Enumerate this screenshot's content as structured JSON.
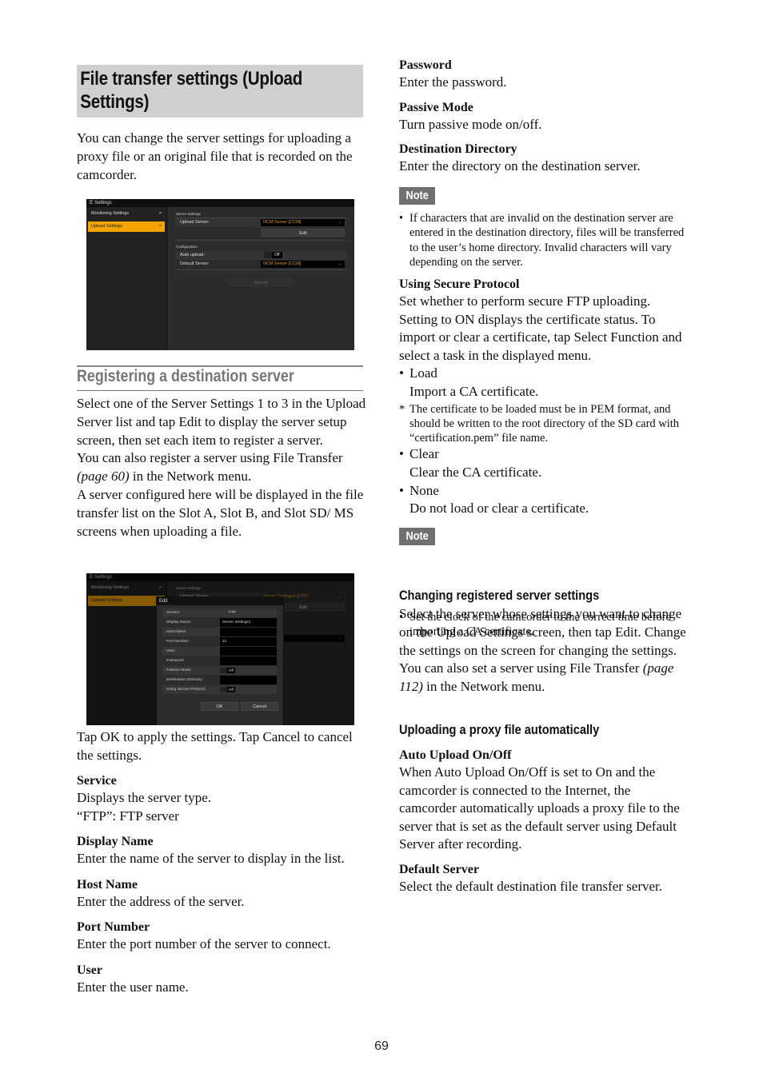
{
  "page": {
    "title": "File transfer settings (Upload Settings)",
    "intro": "You can change the server settings for uploading a proxy file or an original file that is recorded on the camcorder.",
    "page_number": "69"
  },
  "screenshot1": {
    "window_title": "Settings",
    "sidebar": [
      {
        "label": "Monitoring Settings",
        "chevron": ">"
      },
      {
        "label": "Upload Settings",
        "chevron": ">",
        "active": true
      }
    ],
    "server_settings_label": "Server Settings",
    "upload_server_label": "Upload Server:",
    "upload_server_value": "NCM Server [CCM]",
    "edit_button": "Edit",
    "configuration_label": "Configuration",
    "auto_upload_label": "Auto upload:",
    "auto_upload_value": "Off",
    "default_server_label": "Default Server:",
    "default_server_value": "NCM Server [CCM]",
    "submit_button": "Submit",
    "accent_color": "#f3a400"
  },
  "screenshot2": {
    "window_title": "Settings",
    "sidebar": [
      {
        "label": "Monitoring Settings",
        "chevron": ">"
      },
      {
        "label": "Upload Settings",
        "active": true
      }
    ],
    "server_settings_label": "Server Settings",
    "upload_server_label": "Upload Server:",
    "upload_server_value": "Server Settings1 [FTP]",
    "edit_button": "Edit",
    "default_server_partial": "r [CCM]",
    "dialog": {
      "title": "Edit",
      "fields": [
        {
          "label": "Service:",
          "value": "FTP",
          "type": "text"
        },
        {
          "label": "Display Name:",
          "value": "Server Settings1",
          "type": "input"
        },
        {
          "label": "Host Name:",
          "value": "",
          "type": "input"
        },
        {
          "label": "Port Number:",
          "value": "21",
          "type": "input"
        },
        {
          "label": "User:",
          "value": "",
          "type": "input"
        },
        {
          "label": "Password:",
          "value": "",
          "type": "input"
        },
        {
          "label": "Passive Mode:",
          "value": "Off",
          "type": "toggle"
        },
        {
          "label": "Destination Directory:",
          "value": "",
          "type": "input"
        },
        {
          "label": "Using Secure Protocol:",
          "value": "Off",
          "type": "toggle"
        }
      ],
      "ok_button": "OK",
      "cancel_button": "Cancel"
    }
  },
  "registering": {
    "heading": "Registering a destination server",
    "p1": "Select one of the Server Settings 1 to 3 in the Upload Server list and tap Edit to display the server setup screen, then set each item to register a server.",
    "p2_before": "You can also register a server using File Transfer ",
    "p2_ref": "(page 60)",
    "p2_after": " in the Network menu.",
    "p3": "A server configured here will be displayed in the file transfer list on the Slot A, Slot B, and Slot SD/ MS screens when uploading a file.",
    "after_shot": "Tap OK to apply the settings. Tap Cancel to cancel the settings."
  },
  "items_left": [
    {
      "term": "Service",
      "desc": [
        "Displays the server type.",
        "“FTP”: FTP server"
      ]
    },
    {
      "term": "Display Name",
      "desc": [
        "Enter the name of the server to display in the list."
      ]
    },
    {
      "term": "Host Name",
      "desc": [
        "Enter the address of the server."
      ]
    },
    {
      "term": "Port Number",
      "desc": [
        "Enter the port number of the server to connect."
      ]
    },
    {
      "term": "User",
      "desc": [
        "Enter the user name."
      ]
    }
  ],
  "items_right": [
    {
      "term": "Password",
      "desc": "Enter the password."
    },
    {
      "term": "Passive Mode",
      "desc": "Turn passive mode on/off."
    },
    {
      "term": "Destination Directory",
      "desc": "Enter the directory on the destination server."
    }
  ],
  "note1": {
    "label": "Note",
    "text": "If characters that are invalid on the destination server are entered in the destination directory, files will be transferred to the user’s home directory. Invalid characters will vary depending on the server."
  },
  "secure": {
    "term": "Using Secure Protocol",
    "desc": "Set whether to perform secure FTP uploading. Setting to ON displays the certificate status. To import or clear a certificate, tap Select Function and select a task in the displayed menu.",
    "options": [
      {
        "name": "Load",
        "desc": "Import a CA certificate."
      },
      {
        "name": "Clear",
        "desc": "Clear the CA certificate."
      },
      {
        "name": "None",
        "desc": "Do not load or clear a certificate."
      }
    ],
    "footnote": "The certificate to be loaded must be in PEM format, and should be written to the root directory of the SD card with “certification.pem” file name."
  },
  "note2": {
    "label": "Note",
    "text": "Set the clock of the camcorder to the correct time before importing a CA certificate."
  },
  "changing": {
    "heading": "Changing registered server settings",
    "p1": "Select the server whose settings you want to change on the Upload Settings screen, then tap Edit. Change the settings on the screen for changing the settings.",
    "p2_before": "You can also set a server using File Transfer ",
    "p2_ref": "(page 112)",
    "p2_after": " in the Network menu."
  },
  "uploading": {
    "heading": "Uploading a proxy file automatically",
    "items": [
      {
        "term": "Auto Upload On/Off",
        "desc": "When Auto Upload On/Off is set to On and the camcorder is connected to the Internet, the camcorder automatically uploads a proxy file to the server that is set as the default server using Default Server after recording."
      },
      {
        "term": "Default Server",
        "desc": "Select the default destination file transfer server."
      }
    ]
  }
}
